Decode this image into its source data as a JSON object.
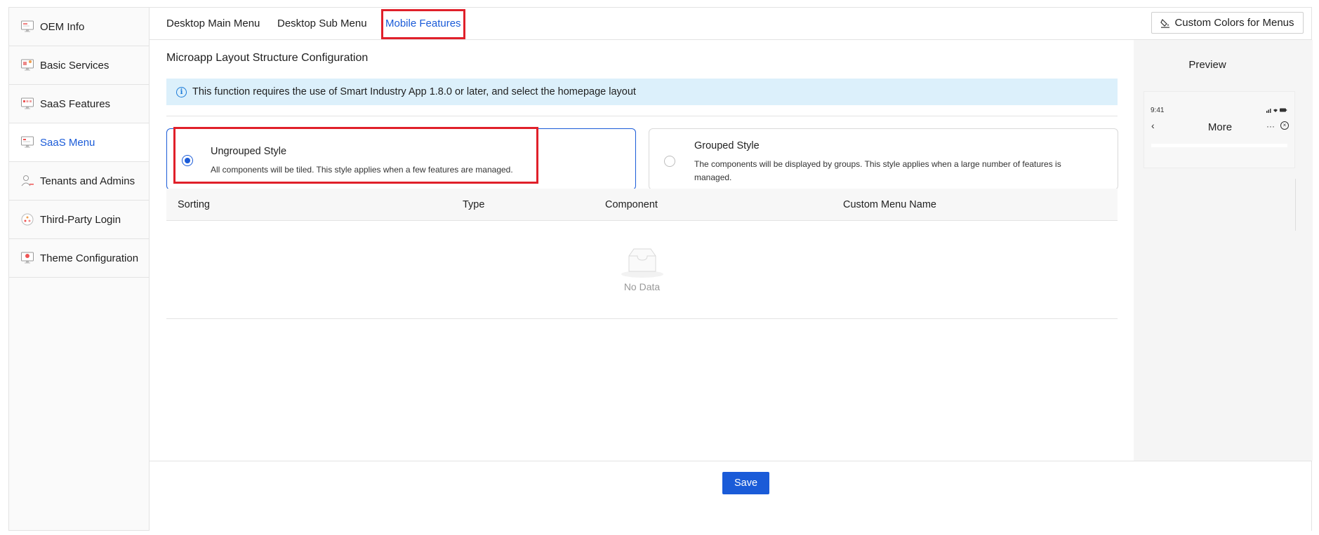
{
  "sidebar": {
    "items": [
      {
        "label": "OEM Info",
        "icon": "monitor-icon"
      },
      {
        "label": "Basic Services",
        "icon": "monitor-services-icon"
      },
      {
        "label": "SaaS Features",
        "icon": "monitor-features-icon"
      },
      {
        "label": "SaaS Menu",
        "icon": "monitor-menu-icon",
        "active": true
      },
      {
        "label": "Tenants and Admins",
        "icon": "user-icon"
      },
      {
        "label": "Third-Party Login",
        "icon": "connect-icon"
      },
      {
        "label": "Theme Configuration",
        "icon": "monitor-theme-icon"
      }
    ]
  },
  "tabs": {
    "items": [
      "Desktop Main Menu",
      "Desktop Sub Menu",
      "Mobile Features"
    ],
    "active": "Mobile Features"
  },
  "toolbar": {
    "custom_colors_label": "Custom Colors for Menus",
    "custom_colors_icon": "paint-bucket-icon"
  },
  "main": {
    "section_title": "Microapp Layout Structure Configuration",
    "info_text": "This function requires the use of Smart Industry App 1.8.0 or later, and select the homepage layout",
    "styles": [
      {
        "title": "Ungrouped Style",
        "description": "All components will be tiled. This style applies when a few features are managed.",
        "selected": true
      },
      {
        "title": "Grouped Style",
        "description": "The components will be displayed by groups. This style applies when a large number of features is managed.",
        "selected": false
      }
    ],
    "table": {
      "columns": [
        "Sorting",
        "Type",
        "Component",
        "Custom Menu Name"
      ],
      "empty_text": "No Data"
    }
  },
  "preview": {
    "title": "Preview",
    "phone": {
      "time": "9:41",
      "header_title": "More",
      "more_symbol": "···",
      "back_symbol": "‹",
      "close_symbol": "×"
    }
  },
  "footer": {
    "save_label": "Save"
  },
  "colors": {
    "accent": "#1a5bd8",
    "highlight": "#e0202a",
    "info_bg": "#dcf0fb"
  }
}
